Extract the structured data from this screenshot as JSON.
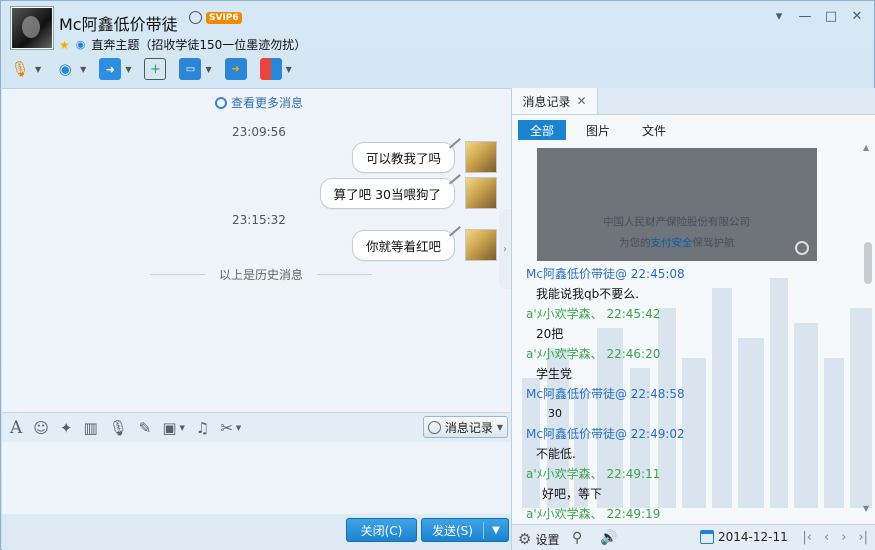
{
  "title": {
    "name": "Mc阿鑫低价带徒",
    "badge": "SVIP6",
    "status": "直奔主题（招收学徒150一位墨迹勿扰）"
  },
  "window_buttons": [
    "▾",
    "—",
    "□",
    "✕"
  ],
  "toolbar": {
    "icons": [
      "microphone-icon",
      "camera-icon",
      "file-transfer-icon",
      "add-note-icon",
      "screen-share-icon",
      "presentation-icon",
      "apps-icon"
    ]
  },
  "chat": {
    "view_more": "查看更多消息",
    "messages": [
      {
        "time": "23:09:56"
      },
      {
        "text": "可以教我了吗"
      },
      {
        "text": "算了吧    30当喂狗了"
      },
      {
        "time": "23:15:32"
      },
      {
        "text": "你就等着红吧"
      }
    ],
    "history_label": "以上是历史消息"
  },
  "editor_toolbar": {
    "icons": [
      "font-icon",
      "emoji-icon",
      "magic-icon",
      "vibrate-icon",
      "voice-icon",
      "edit-icon",
      "image-icon",
      "music-icon",
      "scissors-icon"
    ],
    "record_button": "消息记录"
  },
  "buttons": {
    "close": "关闭(C)",
    "send": "发送(S)"
  },
  "right_panel": {
    "tab": "消息记录",
    "filters": [
      "全部",
      "图片",
      "文件"
    ],
    "card_line1": "中国人民财产保险股份有限公司",
    "card_line2_prefix": "为您的",
    "card_line2_highlight": "支付安全",
    "card_line2_suffix": "保驾护航",
    "log": [
      {
        "sender": "Mc阿鑫低价带徒@ 22:45:08",
        "color": "blue"
      },
      {
        "text": "我能说我qb不要么."
      },
      {
        "sender": "a'ﾒ小欢学森、 22:45:42",
        "color": "green"
      },
      {
        "text": "20把"
      },
      {
        "sender": "a'ﾒ小欢学森、 22:46:20",
        "color": "green"
      },
      {
        "text": "学生党"
      },
      {
        "sender": "Mc阿鑫低价带徒@ 22:48:58",
        "color": "blue"
      },
      {
        "text": "30"
      },
      {
        "sender": "Mc阿鑫低价带徒@ 22:49:02",
        "color": "blue"
      },
      {
        "text": "不能低."
      },
      {
        "sender": "a'ﾒ小欢学森、 22:49:11",
        "color": "green"
      },
      {
        "text": "好吧，等下"
      },
      {
        "sender": "a'ﾒ小欢学森、 22:49:19",
        "color": "green"
      }
    ],
    "settings": "设置",
    "date": "2014-12-11",
    "nav_icons": [
      "first-page-icon",
      "prev-page-icon",
      "next-page-icon",
      "last-page-icon"
    ]
  }
}
